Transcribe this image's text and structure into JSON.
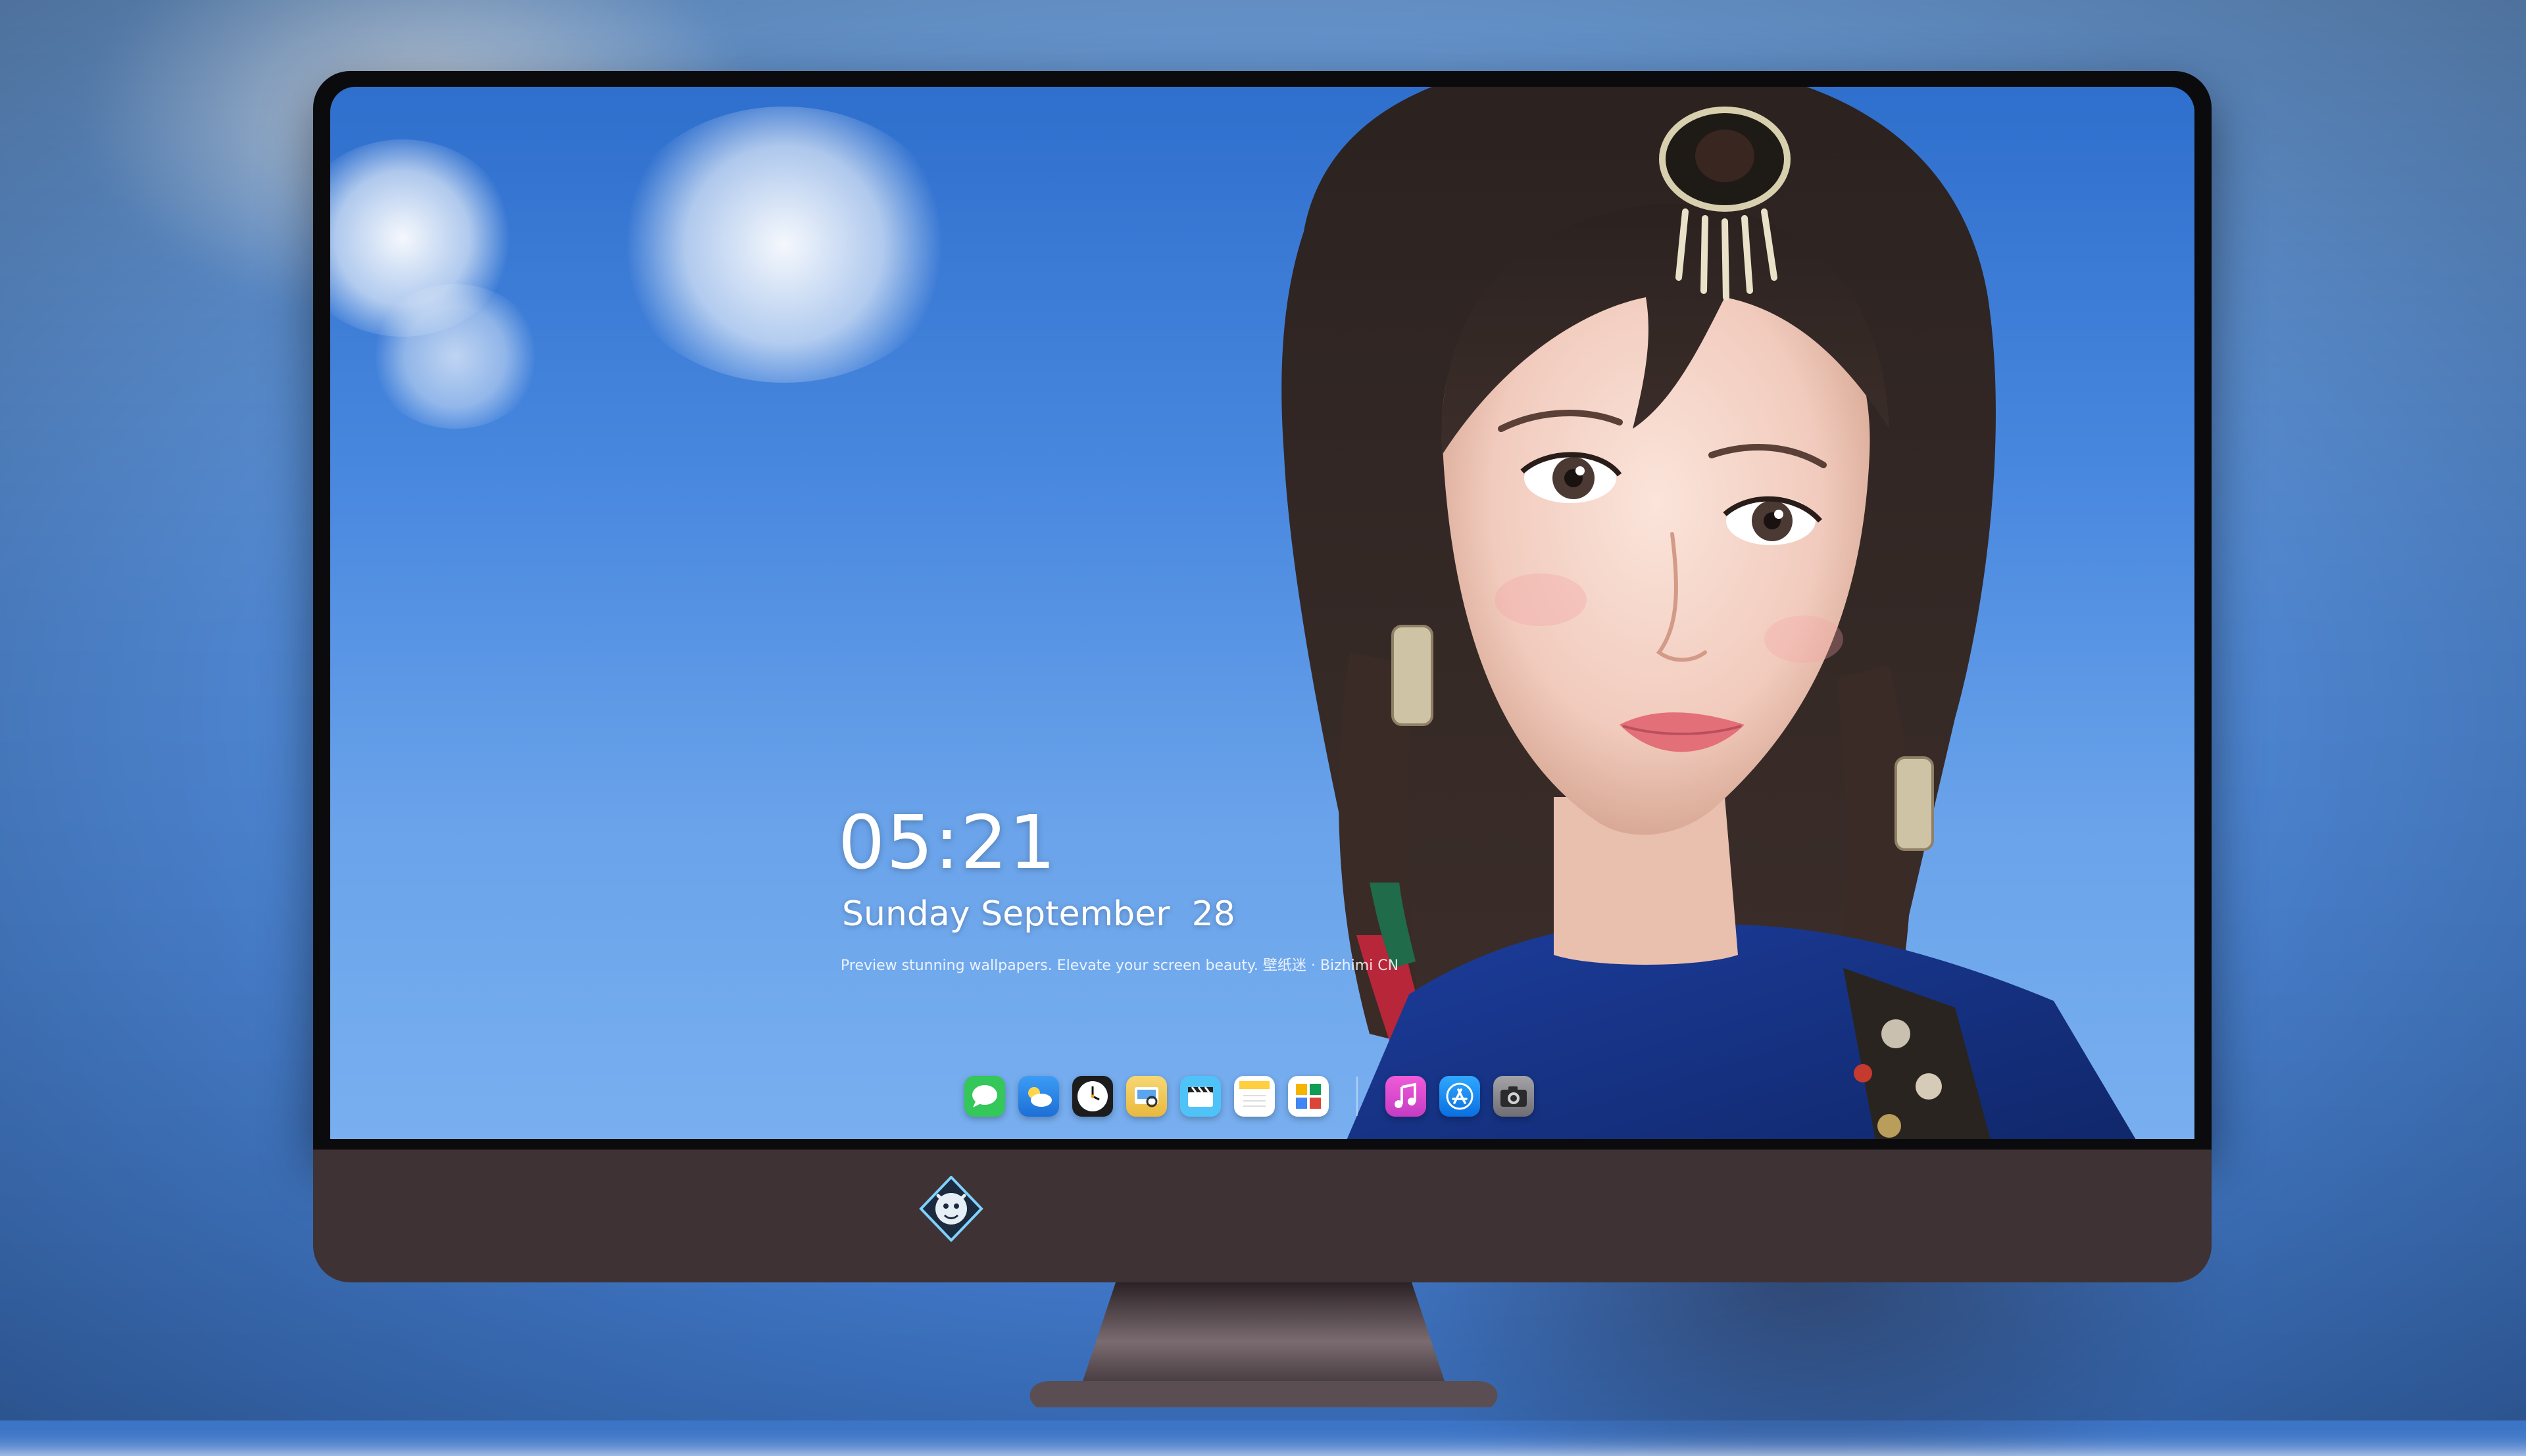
{
  "lockscreen": {
    "time": "05:21",
    "weekday": "Sunday",
    "month": "September",
    "day": "28",
    "tagline": "Preview stunning wallpapers. Elevate your screen beauty. 壁纸迷 · Bizhimi CN"
  },
  "dock": {
    "apps": [
      {
        "name": "Messages",
        "icon": "messages-icon",
        "color": "#34c759"
      },
      {
        "name": "Weather",
        "icon": "weather-icon",
        "color": "#2f8cf0"
      },
      {
        "name": "Clock",
        "icon": "clock-icon",
        "color": "#1c1c1e"
      },
      {
        "name": "Preview",
        "icon": "preview-icon",
        "color": "#f2c94c"
      },
      {
        "name": "Clips",
        "icon": "clapperboard-icon",
        "color": "#4fc3f7"
      },
      {
        "name": "Notes",
        "icon": "notes-icon",
        "color": "#ffd54f"
      },
      {
        "name": "Photo Booth",
        "icon": "photo-grid-icon",
        "color": "#ffffff"
      },
      {
        "name": "Music",
        "icon": "music-note-icon",
        "color": "#e14bd8"
      },
      {
        "name": "App Store",
        "icon": "app-store-icon",
        "color": "#1a8cf5"
      },
      {
        "name": "Camera",
        "icon": "camera-icon",
        "color": "#8e8e93"
      }
    ]
  },
  "colors": {
    "sky": "#4b8ae0",
    "bezel": "#0b0b0d",
    "chin": "#3f3234",
    "text": "#ffffff"
  },
  "branding": {
    "logo": "dragon-emblem-icon"
  }
}
